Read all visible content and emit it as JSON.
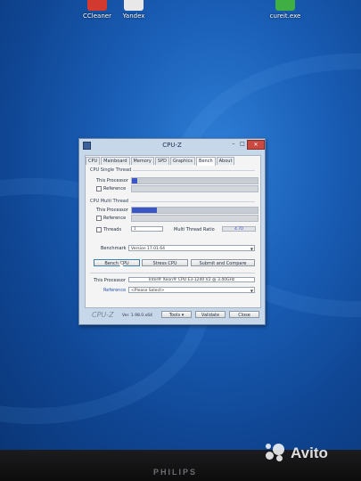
{
  "desktop": {
    "icons": [
      {
        "label": "CCleaner",
        "color": "#d23a2f"
      },
      {
        "label": "Yandex",
        "color": "#e8e8e8"
      },
      {
        "label": "cureit.exe",
        "color": "#3fae43"
      }
    ]
  },
  "window": {
    "title": "CPU-Z",
    "controls": {
      "minimize": "–",
      "maximize": "□",
      "close": "✕"
    },
    "tabs": [
      "CPU",
      "Mainboard",
      "Memory",
      "SPD",
      "Graphics",
      "Bench",
      "About"
    ],
    "active_tab": "Bench",
    "single_thread": {
      "title": "CPU Single Thread",
      "this_processor_label": "This Processor",
      "reference_label": "Reference",
      "this_processor_fill": 0.04,
      "this_processor_value": "",
      "reference_checked": false
    },
    "multi_thread": {
      "title": "CPU Multi Thread",
      "this_processor_label": "This Processor",
      "reference_label": "Reference",
      "threads_label": "Threads",
      "threads_value": "1",
      "ratio_label": "Multi Thread Ratio",
      "ratio_value": "4.70",
      "this_processor_fill": 0.2,
      "this_processor_value": ""
    },
    "benchmark_label": "Benchmark",
    "benchmark_value": "Version 17.01.64",
    "buttons": {
      "bench_cpu": "Bench CPU",
      "stress_cpu": "Stress CPU",
      "submit_compare": "Submit and Compare"
    },
    "processor_label": "This Processor",
    "processor_value": "Intel® Xeon® CPU E3-1240 V2 @ 3.40GHz",
    "reference_label": "Reference",
    "reference_value": "<Please Select>",
    "footer": {
      "logo": "CPU-Z",
      "version": "Ver. 1.98.0.x64",
      "tools": "Tools",
      "validate": "Validate",
      "close": "Close"
    }
  },
  "monitor": {
    "brand": "PHILIPS"
  },
  "watermark": {
    "text": "Avito"
  },
  "colors": {
    "accent_fill": "#3b56c6",
    "close_button": "#c94a43"
  }
}
